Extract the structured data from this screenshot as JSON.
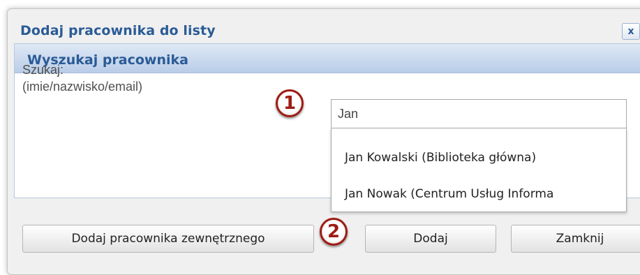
{
  "dialog": {
    "title": "Dodaj pracownika do listy",
    "close_label": "x"
  },
  "search_section": {
    "title": "Wyszukaj pracownika",
    "label_line1": "Szukaj:",
    "label_line2": "(imie/nazwisko/email)",
    "input_value": "Jan",
    "suggestions": [
      "Jan Kowalski (Biblioteka główna)",
      "Jan Nowak (Centrum Usług Informa"
    ]
  },
  "steps": {
    "step1": "1",
    "step2": "2"
  },
  "buttons": {
    "add_external": "Dodaj pracownika zewnętrznego",
    "add": "Dodaj",
    "close": "Zamknij"
  },
  "colors": {
    "title": "#2a5b96",
    "badge": "#9e1b12"
  }
}
